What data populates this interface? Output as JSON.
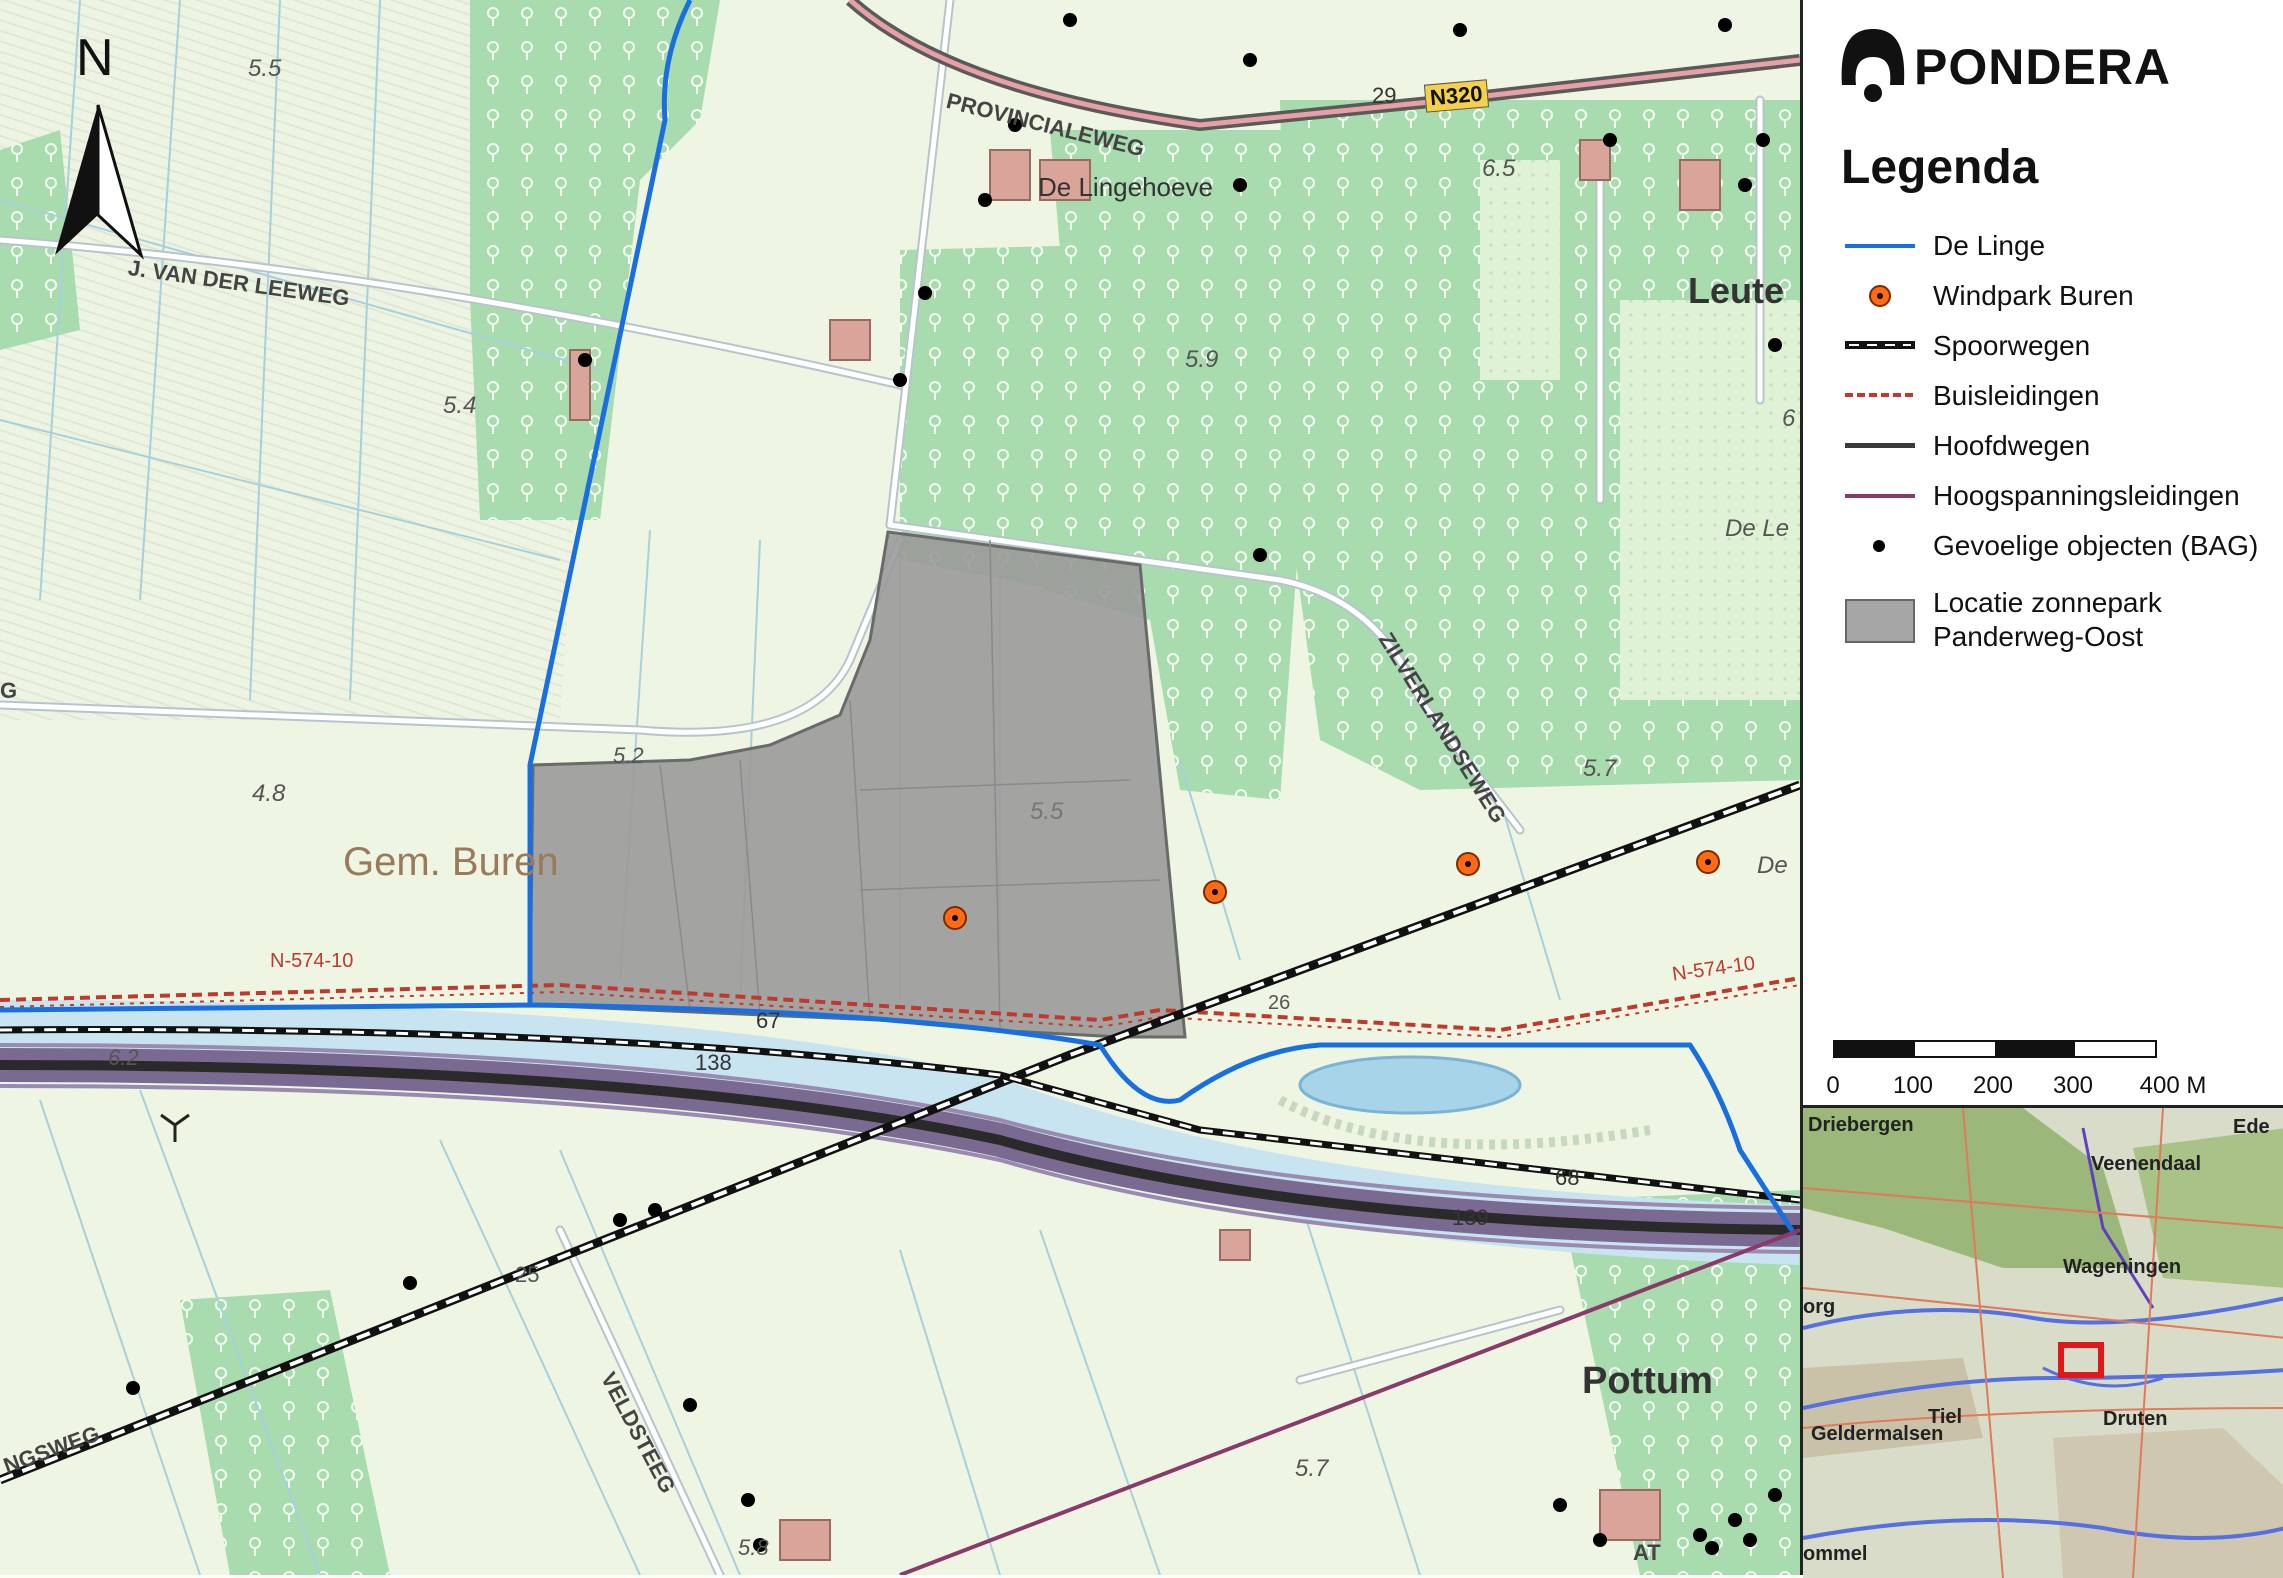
{
  "logo": {
    "text": "PONDERA"
  },
  "legend": {
    "title": "Legenda",
    "items": [
      {
        "id": "de-linge",
        "label": "De Linge",
        "color": "#1a6fe0"
      },
      {
        "id": "windpark",
        "label": "Windpark Buren",
        "color": "#ff6a13"
      },
      {
        "id": "spoorwegen",
        "label": "Spoorwegen",
        "color": "#000000"
      },
      {
        "id": "buisleidingen",
        "label": "Buisleidingen",
        "color": "#c0392b"
      },
      {
        "id": "hoofdwegen",
        "label": "Hoofdwegen",
        "color": "#3a3a3a"
      },
      {
        "id": "hoogspanning",
        "label": "Hoogspanningsleidingen",
        "color": "#8a3a6a"
      },
      {
        "id": "gevoelig",
        "label": "Gevoelige objecten (BAG)",
        "color": "#000000"
      },
      {
        "id": "zonnepark",
        "label": "Locatie zonnepark\nPanderweg-Oost",
        "label_line1": "Locatie zonnepark",
        "label_line2": "Panderweg-Oost",
        "color": "#a6a6a6"
      }
    ]
  },
  "scalebar": {
    "ticks": [
      "0",
      "100",
      "200",
      "300",
      "400 M"
    ]
  },
  "north": {
    "label": "N"
  },
  "map": {
    "place_labels": {
      "gem_buren": "Gem. Buren",
      "pottum": "Pottum",
      "leute": "Leute",
      "de_lingehoeve": "De Lingehoeve",
      "de_le": "De Le",
      "de": "De"
    },
    "road_labels": {
      "provincialeweg": "PROVINCIALEWEG",
      "j_van_der_leeweg": "J. VAN DER LEEWEG",
      "zilverlandseweg": "ZILVERLANDSEWEG",
      "veldsteeg": "VELDSTEEG",
      "ngsweg": "NGSWEG",
      "n320": "N320",
      "km29": "29",
      "g": "G",
      "at": "AT"
    },
    "pipeline_labels": {
      "left": "N-574-10",
      "right": "N-574-10"
    },
    "elevations": {
      "e55a": "5.5",
      "e54": "5.4",
      "e48": "4.8",
      "e52": "5.2",
      "e55b": "5.5",
      "e59": "5.9",
      "e65": "6.5",
      "e57a": "5.7",
      "e62": "6.2",
      "e57b": "5.7",
      "e58": "5.8",
      "e25": "25",
      "e6": "6",
      "e26": "26"
    },
    "road_numbers": {
      "r67": "67",
      "r138": "138",
      "r139": "139",
      "r68": "68"
    }
  },
  "inset": {
    "labels": {
      "driebergen": "Driebergen",
      "ede": "Ede",
      "veenendaal": "Veenendaal",
      "wageningen": "Wageningen",
      "org": "org",
      "tiel": "Tiel",
      "geldermalsen": "Geldermalsen",
      "druten": "Druten",
      "ommel": "ommel"
    }
  }
}
